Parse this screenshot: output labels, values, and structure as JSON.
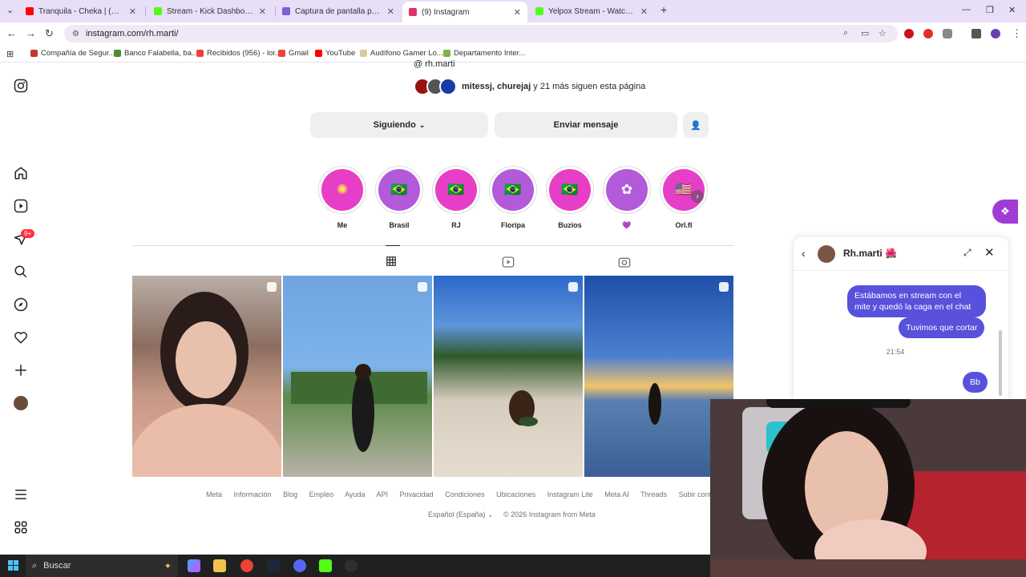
{
  "browser": {
    "tabs": [
      {
        "label": "Tranquila - Cheka | (Prod. S",
        "color": "#ff0000",
        "active": false
      },
      {
        "label": "Stream - Kick Dashboard",
        "color": "#53fc18",
        "active": false
      },
      {
        "label": "Captura de pantalla por Lightsh",
        "color": "#7b5fd4",
        "active": false
      },
      {
        "label": "(9) Instagram",
        "color": "#e1306c",
        "active": true
      },
      {
        "label": "Yelpox Stream - Watch Live on",
        "color": "#53fc18",
        "active": false
      }
    ],
    "url": "instagram.com/rh.marti/",
    "bookmarks": [
      {
        "label": "Compañía de Segur...",
        "color": "#c0392b"
      },
      {
        "label": "Banco Falabella, ba...",
        "color": "#4a8b2f"
      },
      {
        "label": "Recibidos (956) - lor...",
        "color": "#ea4335"
      },
      {
        "label": "Gmail",
        "color": "#ea4335"
      },
      {
        "label": "YouTube",
        "color": "#ff0000"
      },
      {
        "label": "Audífono Gamer Lo...",
        "color": "#d8c9a0"
      },
      {
        "label": "Departamento Inter...",
        "color": "#7cb342"
      }
    ]
  },
  "sidebar": {
    "notification_badge": "9+"
  },
  "profile": {
    "username_top": "rh.marti",
    "followers_names": "mitessj, churejaj",
    "followers_suffix": " y 21 más siguen esta página",
    "following_button": "Siguiendo",
    "message_button": "Enviar mensaje",
    "highlights": [
      {
        "label": "Me",
        "glyph": "✺",
        "bg": "#e63ec6"
      },
      {
        "label": "Brasil",
        "glyph": "🇧🇷",
        "bg": "#b25ad9"
      },
      {
        "label": "RJ",
        "glyph": "🇧🇷",
        "bg": "#e63ec6"
      },
      {
        "label": "Floripa",
        "glyph": "🇧🇷",
        "bg": "#b25ad9"
      },
      {
        "label": "Buzios",
        "glyph": "🇧🇷",
        "bg": "#e63ec6"
      },
      {
        "label": "💜",
        "glyph": "✿",
        "bg": "#b25ad9"
      },
      {
        "label": "Orl.fl",
        "glyph": "🇺🇸",
        "bg": "#e63ec6"
      }
    ]
  },
  "footer": {
    "links": [
      "Meta",
      "Información",
      "Blog",
      "Empleo",
      "Ayuda",
      "API",
      "Privacidad",
      "Condiciones",
      "Ubicaciones",
      "Instagram Lite",
      "Meta AI",
      "Threads",
      "Subir contactos y perso"
    ],
    "language": "Español (España)",
    "copyright": "© 2026 Instagram from Meta"
  },
  "dm": {
    "name": "Rh.marti 🌺",
    "messages": [
      "Estábamos en stream con el mite y quedó la caga en el chat",
      "Tuvimos que cortar",
      "Bb"
    ],
    "time": "21:54"
  },
  "taskbar": {
    "search_placeholder": "Buscar"
  },
  "colors": {
    "accent": "#5851db",
    "badge": "#ff3040",
    "chrome_bg": "#e8def8"
  }
}
